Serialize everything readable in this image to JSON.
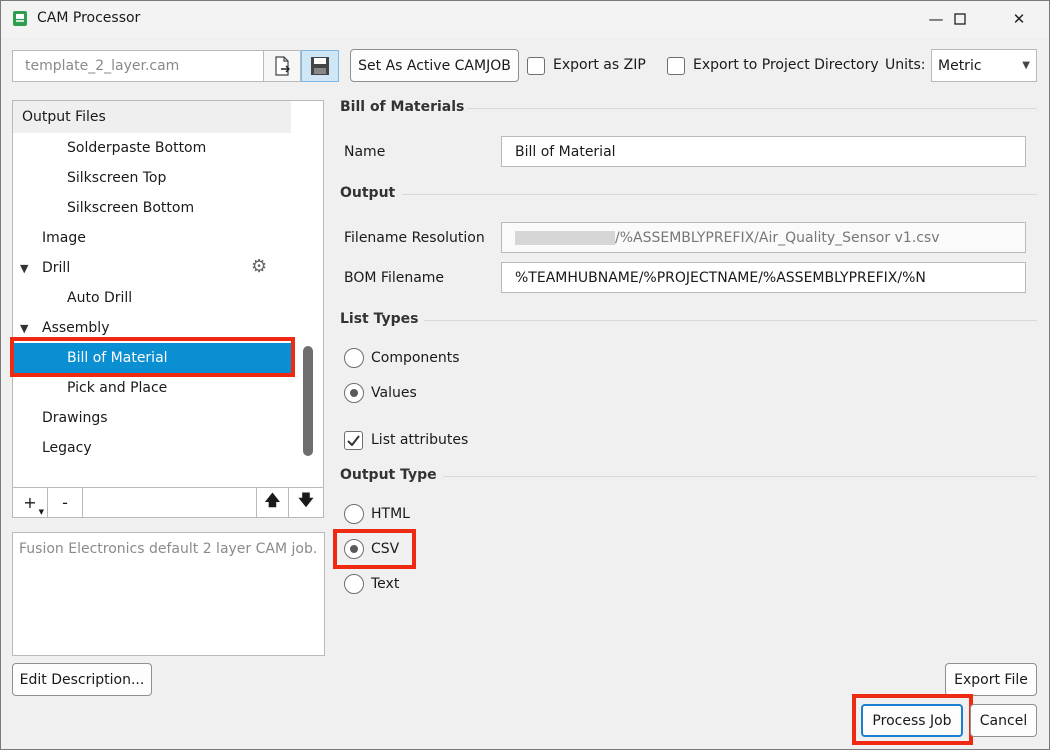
{
  "window": {
    "title": "CAM Processor",
    "minimize": "—",
    "maximize": "☐",
    "close": "✕"
  },
  "toolbar": {
    "template_value": "template_2_layer.cam",
    "set_active_label": "Set As Active CAMJOB",
    "export_zip_label": "Export as ZIP",
    "export_zip_checked": false,
    "export_project_label": "Export to Project Directory",
    "export_project_checked": false,
    "units_label": "Units:",
    "units_value": "Metric"
  },
  "tree": {
    "header": "Output Files",
    "items": [
      {
        "label": "Solderpaste Bottom"
      },
      {
        "label": "Silkscreen Top"
      },
      {
        "label": "Silkscreen Bottom"
      },
      {
        "label": "Image"
      },
      {
        "label": "Drill"
      },
      {
        "label": "Auto Drill"
      },
      {
        "label": "Assembly"
      },
      {
        "label": "Bill of Material"
      },
      {
        "label": "Pick and Place"
      },
      {
        "label": "Drawings"
      },
      {
        "label": "Legacy"
      }
    ],
    "add_label": "+",
    "remove_label": "-",
    "up_label": "🡅",
    "down_label": "🡇"
  },
  "description": "Fusion Electronics default 2 layer CAM job.",
  "edit_description_label": "Edit Description...",
  "bom": {
    "section_title": "Bill of Materials",
    "name_label": "Name",
    "name_value": "Bill of Material",
    "output_title": "Output",
    "filename_resolution_label": "Filename Resolution",
    "filename_resolution_value": "/%ASSEMBLYPREFIX/Air_Quality_Sensor v1.csv",
    "bom_filename_label": "BOM Filename",
    "bom_filename_value": "%TEAMHUBNAME/%PROJECTNAME/%ASSEMBLYPREFIX/%N",
    "list_types_title": "List Types",
    "components_label": "Components",
    "values_label": "Values",
    "list_attributes_label": "List attributes",
    "output_type_title": "Output Type",
    "html_label": "HTML",
    "csv_label": "CSV",
    "text_label": "Text"
  },
  "buttons": {
    "export_file": "Export File",
    "process_job": "Process Job",
    "cancel": "Cancel"
  },
  "colors": {
    "selection": "#0a8fd3",
    "highlight": "#ee2a12"
  }
}
